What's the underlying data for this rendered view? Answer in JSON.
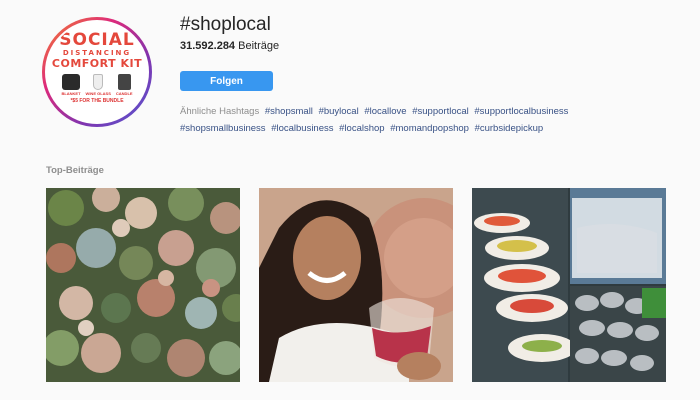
{
  "hashtag": {
    "title": "#shoplocal",
    "count": "31.592.284",
    "count_suffix": " Beiträge",
    "follow_label": "Folgen"
  },
  "avatar": {
    "line1": "SOCIAL",
    "line2": "DISTANCING",
    "line3": "COMFORT KIT",
    "products": [
      "BLANKET",
      "WINE GLASS",
      "CANDLE"
    ],
    "price": "*$5 FOR THE BUNDLE"
  },
  "related": {
    "label": "Ähnliche Hashtags",
    "tags": [
      "#shopsmall",
      "#buylocal",
      "#locallove",
      "#supportlocal",
      "#supportlocalbusiness",
      "#shopsmallbusiness",
      "#localbusiness",
      "#localshop",
      "#momandpopshop",
      "#curbsidepickup"
    ]
  },
  "top_posts": {
    "label": "Top-Beiträge",
    "items": [
      {
        "subject": "flower arrangement"
      },
      {
        "subject": "woman holding wine glass"
      },
      {
        "subject": "wrapped food trays"
      }
    ]
  },
  "colors": {
    "follow": "#3897f0",
    "link": "#385185",
    "muted": "#8e8e8e"
  }
}
